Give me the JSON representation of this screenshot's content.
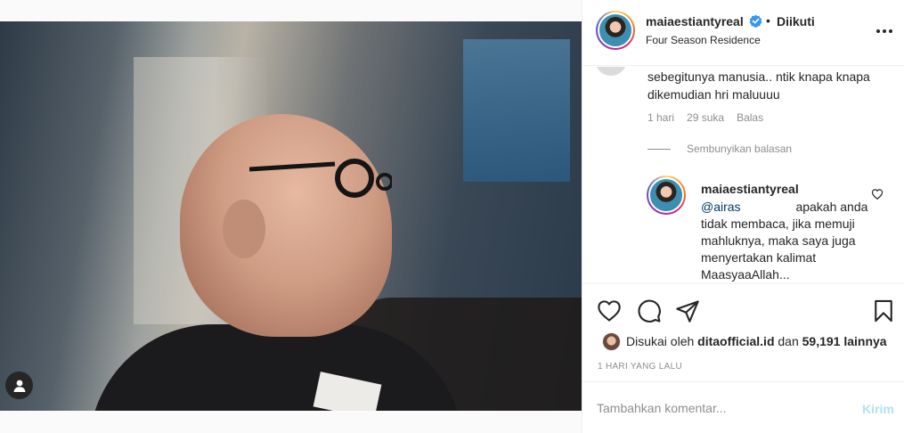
{
  "post": {
    "username": "maiaestiantyreal",
    "follow_status": "Diikuti",
    "dot": "•",
    "location": "Four Season Residence"
  },
  "comments": {
    "partial_comment": "sebegitunya manusia.. ntik knapa knapa dikemudian hri maluuuu",
    "meta": {
      "time": "1 hari",
      "likes": "29 suka",
      "reply": "Balas"
    },
    "hide_replies": "Sembunyikan balasan",
    "reply": {
      "username": "maiaestiantyreal",
      "mention": "@airas",
      "text": "apakah anda tidak membaca, jika memuji mahluknya, maka saya juga menyertakan kalimat MaasyaaAllah..."
    }
  },
  "likes": {
    "prefix": "Disukai oleh",
    "user": "ditaofficial.id",
    "conj": "dan",
    "count": "59,191 lainnya"
  },
  "timestamp": "1 HARI YANG LALU",
  "comment_box": {
    "placeholder": "Tambahkan komentar...",
    "post_label": "Kirim"
  },
  "colors": {
    "verified": "#3897f0",
    "link": "#00376b",
    "post_disabled": "#b2dffc"
  }
}
